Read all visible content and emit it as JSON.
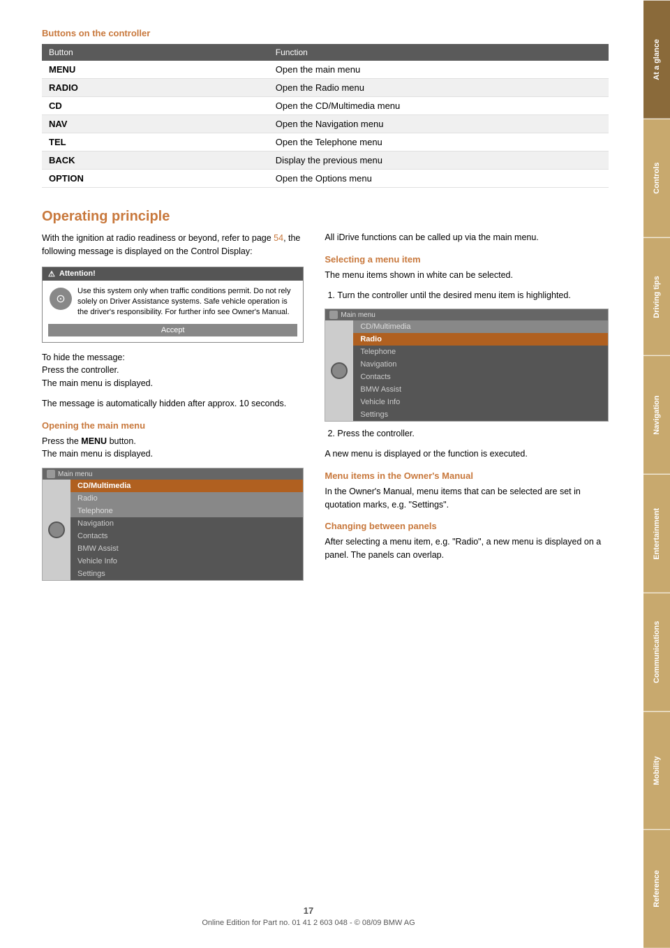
{
  "sidebar": {
    "tabs": [
      {
        "label": "At a glance",
        "active": true
      },
      {
        "label": "Controls",
        "active": false
      },
      {
        "label": "Driving tips",
        "active": false
      },
      {
        "label": "Navigation",
        "active": false
      },
      {
        "label": "Entertainment",
        "active": false
      },
      {
        "label": "Communications",
        "active": false
      },
      {
        "label": "Mobility",
        "active": false
      },
      {
        "label": "Reference",
        "active": false
      }
    ]
  },
  "buttons_section": {
    "title": "Buttons on the controller",
    "table": {
      "col1_header": "Button",
      "col2_header": "Function",
      "rows": [
        {
          "button": "MENU",
          "function": "Open the main menu"
        },
        {
          "button": "RADIO",
          "function": "Open the Radio menu"
        },
        {
          "button": "CD",
          "function": "Open the CD/Multimedia menu"
        },
        {
          "button": "NAV",
          "function": "Open the Navigation menu"
        },
        {
          "button": "TEL",
          "function": "Open the Telephone menu"
        },
        {
          "button": "BACK",
          "function": "Display the previous menu"
        },
        {
          "button": "OPTION",
          "function": "Open the Options menu"
        }
      ]
    }
  },
  "operating_principle": {
    "title": "Operating principle",
    "intro_text": "With the ignition at radio readiness or beyond, refer to page 54, the following message is displayed on the Control Display:",
    "page_link": "54",
    "attention_box": {
      "header": "Attention!",
      "text": "Use this system only when traffic conditions permit. Do not rely solely on Driver Assistance systems. Safe vehicle operation is the driver's responsibility. For further info see Owner's Manual.",
      "accept_label": "Accept"
    },
    "hide_message_text": "To hide the message:\nPress the controller.\nThe main menu is displayed.",
    "auto_hide_text": "The message is automatically hidden after approx. 10 seconds.",
    "opening_main_menu": {
      "heading": "Opening the main menu",
      "text": "Press the MENU button.\nThe main menu is displayed.",
      "menu_bold": "MENU"
    },
    "main_menu_items_left": [
      {
        "label": "CD/Multimedia",
        "style": "highlighted"
      },
      {
        "label": "Radio",
        "style": "medium"
      },
      {
        "label": "Telephone",
        "style": "medium"
      },
      {
        "label": "Navigation",
        "style": "dark"
      },
      {
        "label": "Contacts",
        "style": "dark"
      },
      {
        "label": "BMW Assist",
        "style": "dark"
      },
      {
        "label": "Vehicle Info",
        "style": "dark"
      },
      {
        "label": "Settings",
        "style": "dark"
      }
    ],
    "right_col": {
      "intro_text": "All iDrive functions can be called up via the main menu.",
      "selecting_heading": "Selecting a menu item",
      "selecting_text": "The menu items shown in white can be selected.",
      "step1": "Turn the controller until the desired menu item is highlighted.",
      "main_menu_items_right": [
        {
          "label": "CD/Multimedia",
          "style": "medium"
        },
        {
          "label": "Radio",
          "style": "highlighted"
        },
        {
          "label": "Telephone",
          "style": "dark"
        },
        {
          "label": "Navigation",
          "style": "dark"
        },
        {
          "label": "Contacts",
          "style": "dark"
        },
        {
          "label": "BMW Assist",
          "style": "dark"
        },
        {
          "label": "Vehicle Info",
          "style": "dark"
        },
        {
          "label": "Settings",
          "style": "dark"
        }
      ],
      "step2": "Press the controller.",
      "step2_result": "A new menu is displayed or the function is executed.",
      "owners_manual_heading": "Menu items in the Owner's Manual",
      "owners_manual_text": "In the Owner's Manual, menu items that can be selected are set in quotation marks, e.g. \"Settings\".",
      "changing_panels_heading": "Changing between panels",
      "changing_panels_text": "After selecting a menu item, e.g. \"Radio\", a new menu is displayed on a panel. The panels can overlap."
    }
  },
  "footer": {
    "page_number": "17",
    "footer_text": "Online Edition for Part no. 01 41 2 603 048 - © 08/09 BMW AG"
  },
  "menu_title": "Main menu",
  "menu_title2": "Main menu"
}
